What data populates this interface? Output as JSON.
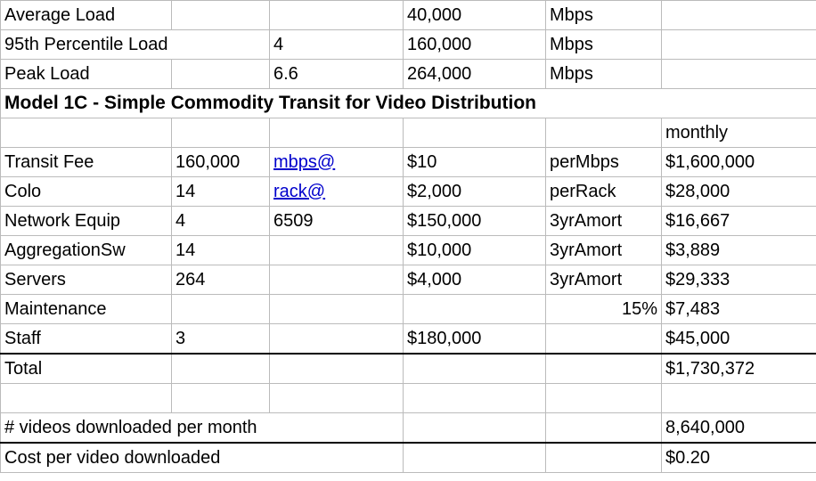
{
  "rows": {
    "avgLoad": {
      "label": "Average Load",
      "c1": "",
      "c2": "",
      "c3": "40,000",
      "c4": "Mbps",
      "c5": ""
    },
    "pct95": {
      "label": "95th Percentile Load",
      "c1": "",
      "c2": "4",
      "c3": "160,000",
      "c4": "Mbps",
      "c5": ""
    },
    "peak": {
      "label": "Peak Load",
      "c1": "",
      "c2": "6.6",
      "c3": "264,000",
      "c4": "Mbps",
      "c5": ""
    },
    "header": {
      "label": "Model 1C - Simple Commodity Transit for Video Distribution"
    },
    "monthly": {
      "c5": "monthly"
    },
    "transit": {
      "label": "Transit Fee",
      "c1": "160,000",
      "c2": "mbps@",
      "c3": "$10",
      "c4": "perMbps",
      "c5": "$1,600,000"
    },
    "colo": {
      "label": "Colo",
      "c1": "14",
      "c2": "rack@",
      "c3": "$2,000",
      "c4": "perRack",
      "c5": "$28,000"
    },
    "neteq": {
      "label": "Network Equip",
      "c1": "4",
      "c2": "6509",
      "c3": "$150,000",
      "c4": "3yrAmort",
      "c5": "$16,667"
    },
    "aggsw": {
      "label": "AggregationSw",
      "c1": "14",
      "c2": "",
      "c3": "$10,000",
      "c4": "3yrAmort",
      "c5": "$3,889"
    },
    "servers": {
      "label": "Servers",
      "c1": "264",
      "c2": "",
      "c3": "$4,000",
      "c4": "3yrAmort",
      "c5": "$29,333"
    },
    "maint": {
      "label": "Maintenance",
      "c1": "",
      "c2": "",
      "c3": "",
      "c4": "15%",
      "c5": "$7,483"
    },
    "staff": {
      "label": "Staff",
      "c1": "3",
      "c2": "",
      "c3": "$180,000",
      "c4": "",
      "c5": "$45,000"
    },
    "total": {
      "label": "Total",
      "c5": "$1,730,372"
    },
    "videos": {
      "label": "# videos downloaded per month",
      "c5": "8,640,000"
    },
    "costper": {
      "label": "Cost per video downloaded",
      "c5": "$0.20"
    }
  }
}
